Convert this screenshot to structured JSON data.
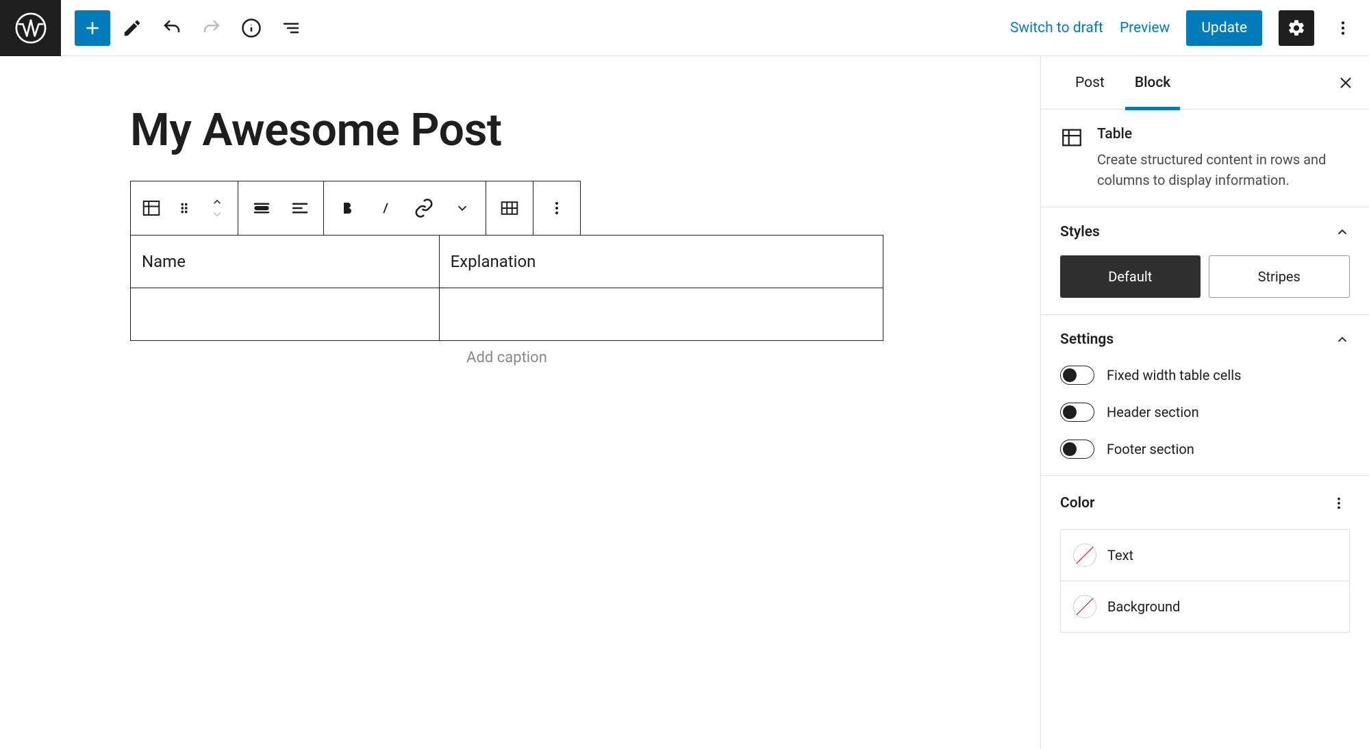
{
  "topbar": {
    "switch_draft": "Switch to draft",
    "preview": "Preview",
    "update": "Update"
  },
  "editor": {
    "title": "My Awesome Post",
    "table": {
      "rows": [
        [
          "Name",
          "Explanation"
        ],
        [
          "",
          ""
        ]
      ]
    },
    "caption_placeholder": "Add caption"
  },
  "sidebar": {
    "tabs": {
      "post": "Post",
      "block": "Block"
    },
    "block_info": {
      "name": "Table",
      "desc": "Create structured content in rows and columns to display information."
    },
    "styles": {
      "label": "Styles",
      "default": "Default",
      "stripes": "Stripes"
    },
    "settings": {
      "label": "Settings",
      "fixed_width": "Fixed width table cells",
      "header": "Header section",
      "footer": "Footer section"
    },
    "color": {
      "label": "Color",
      "text": "Text",
      "background": "Background"
    }
  }
}
